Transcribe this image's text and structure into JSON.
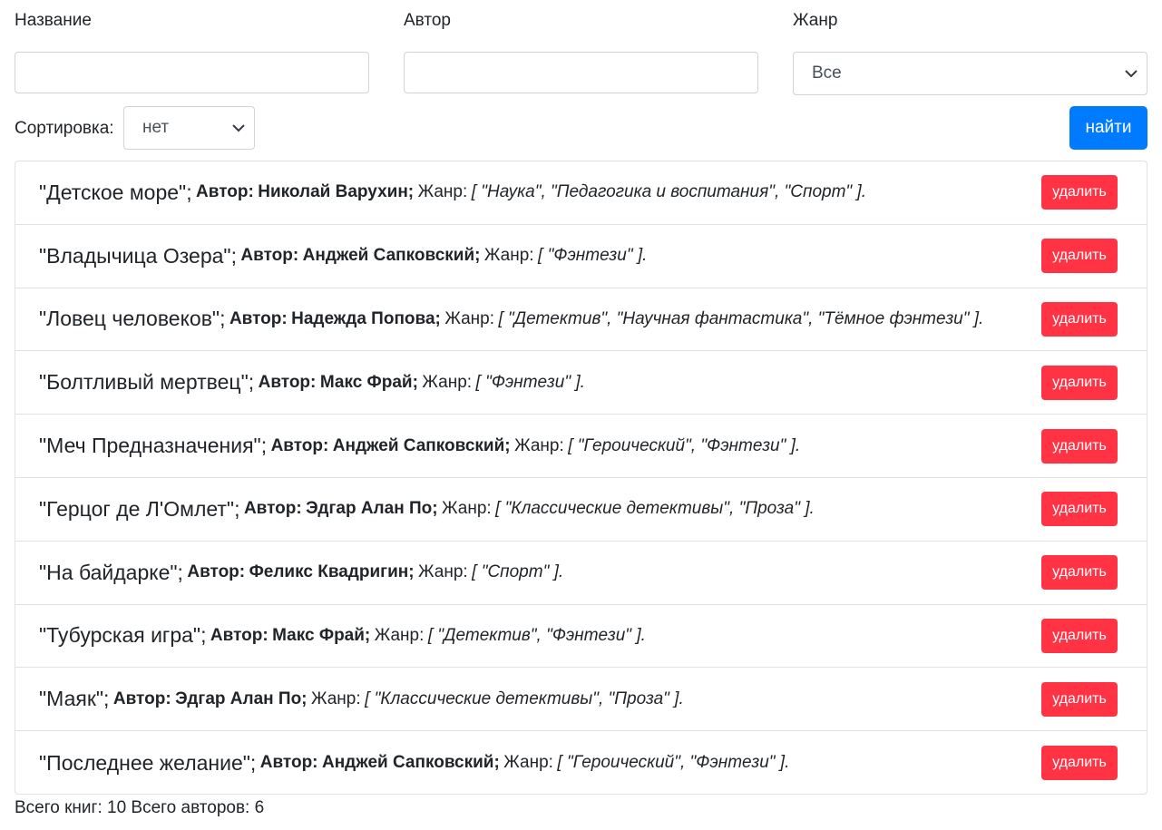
{
  "filters": {
    "title_label": "Название",
    "title_value": "",
    "author_label": "Автор",
    "author_value": "",
    "genre_label": "Жанр",
    "genre_selected": "Все",
    "sort_label": "Сортировка:",
    "sort_selected": "нет",
    "find_label": "найти"
  },
  "list_text": {
    "author_prefix": "Автор:",
    "genre_prefix": "Жанр:"
  },
  "books": [
    {
      "title": "\"Детское море\";",
      "author": "Николай Варухин;",
      "genres": "[ \"Наука\", \"Педагогика и воспитания\", \"Спорт\" ].",
      "delete_label": "удалить"
    },
    {
      "title": "\"Владычица Озера\";",
      "author": "Анджей Сапковский;",
      "genres": "[ \"Фэнтези\" ].",
      "delete_label": "удалить"
    },
    {
      "title": "\"Ловец человеков\";",
      "author": "Надежда Попова;",
      "genres": "[ \"Детектив\", \"Научная фантастика\", \"Тёмное фэнтези\" ].",
      "delete_label": "удалить"
    },
    {
      "title": "\"Болтливый мертвец\";",
      "author": "Макс Фрай;",
      "genres": "[ \"Фэнтези\" ].",
      "delete_label": "удалить"
    },
    {
      "title": "\"Меч Предназначения\";",
      "author": "Анджей Сапковский;",
      "genres": "[ \"Героический\", \"Фэнтези\" ].",
      "delete_label": "удалить"
    },
    {
      "title": "\"Герцог де Л'Омлет\";",
      "author": "Эдгар Алан По;",
      "genres": "[ \"Классические детективы\", \"Проза\" ].",
      "delete_label": "удалить"
    },
    {
      "title": "\"На байдарке\";",
      "author": "Феликс Квадригин;",
      "genres": "[ \"Спорт\" ].",
      "delete_label": "удалить"
    },
    {
      "title": "\"Тубурская игра\";",
      "author": "Макс Фрай;",
      "genres": "[ \"Детектив\", \"Фэнтези\" ].",
      "delete_label": "удалить"
    },
    {
      "title": "\"Маяк\";",
      "author": "Эдгар Алан По;",
      "genres": "[ \"Классические детективы\", \"Проза\" ].",
      "delete_label": "удалить"
    },
    {
      "title": "\"Последнее желание\";",
      "author": "Анджей Сапковский;",
      "genres": "[ \"Героический\", \"Фэнтези\" ].",
      "delete_label": "удалить"
    }
  ],
  "footer": {
    "text": "Всего книг: 10 Всего авторов: 6"
  },
  "colors": {
    "primary": "#007bff",
    "danger": "#ff3344",
    "border": "#ced4da"
  }
}
